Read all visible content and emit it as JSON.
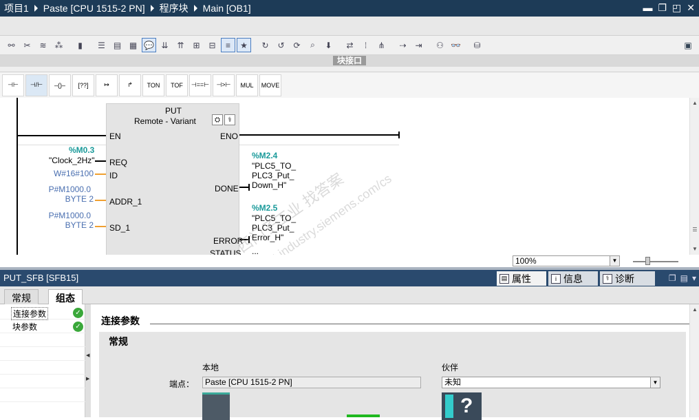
{
  "title_bar": {
    "breadcrumbs": [
      "项目1",
      "Paste [CPU 1515-2 PN]",
      "程序块",
      "Main [OB1]"
    ]
  },
  "block_interface": {
    "label": "块接口"
  },
  "instructions": [
    "TON",
    "TOF",
    "MUL",
    "MOVE"
  ],
  "ladder": {
    "block": {
      "name": "PUT",
      "sub_left": "Remote",
      "sub_sep": "-",
      "sub_right": "Variant"
    },
    "pins": {
      "en": "EN",
      "eno": "ENO",
      "req": "REQ",
      "id": "ID",
      "addr1": "ADDR_1",
      "sd1": "SD_1",
      "done": "DONE",
      "error": "ERROR",
      "status": "STATUS"
    },
    "req_address": "%M0.3",
    "req_tag": "\"Clock_2Hz\"",
    "id_value": "W#16#100",
    "addr1_value": [
      "P#M1000.0",
      "BYTE 2"
    ],
    "sd1_value": [
      "P#M1000.0",
      "BYTE 2"
    ],
    "done_address": "%M2.4",
    "done_tag": [
      "\"PLC5_TO_",
      "PLC3_Put_",
      "Down_H\""
    ],
    "error_address": "%M2.5",
    "error_tag": [
      "\"PLC5_TO_",
      "PLC3_Put_",
      "Error_H\""
    ],
    "status_value": "..."
  },
  "watermark": {
    "cn": "西门子工业 找答案",
    "url": "support.industry.siemens.com/cs"
  },
  "zoom": {
    "value": "100%"
  },
  "inspector": {
    "title": "PUT_SFB [SFB15]",
    "tabs": [
      "属性",
      "信息",
      "诊断"
    ],
    "subtabs": [
      "常规",
      "组态"
    ],
    "nav_items": [
      "连接参数",
      "块参数"
    ],
    "section_title": "连接参数",
    "panel_title": "常规",
    "local_label": "本地",
    "partner_label": "伙伴",
    "endpoint_label": "端点：",
    "local_value": "Paste [CPU 1515-2 PN]",
    "partner_value": "未知"
  }
}
